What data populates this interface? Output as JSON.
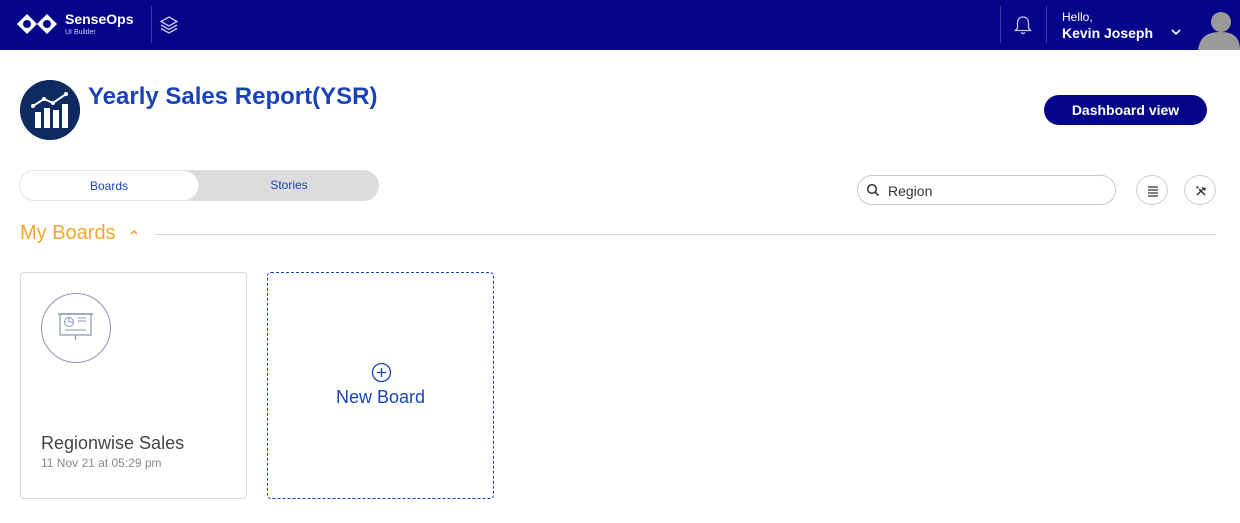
{
  "header": {
    "brand_name": "SenseOps",
    "brand_sub": "UI Builder",
    "greeting": "Hello,",
    "user_name": "Kevin Joseph"
  },
  "report": {
    "title": "Yearly Sales Report(YSR)",
    "dashboard_button": "Dashboard view"
  },
  "tabs": [
    {
      "label": "Boards",
      "active": true
    },
    {
      "label": "Stories",
      "active": false
    }
  ],
  "search": {
    "value": "Region",
    "placeholder": ""
  },
  "section": {
    "title": "My Boards"
  },
  "boards": [
    {
      "name": "Regionwise Sales",
      "date": "11 Nov 21 at 05:29 pm"
    }
  ],
  "new_board": {
    "label": "New Board"
  },
  "colors": {
    "topbar": "#05058a",
    "accent": "#1a43b8",
    "section": "#f4a52b"
  },
  "icons": [
    "senseops-logo-icon",
    "layers-icon",
    "bell-icon",
    "chevron-down-icon",
    "avatar-icon",
    "chart-icon",
    "search-icon",
    "list-icon",
    "tools-icon",
    "chevron-up-icon",
    "presentation-board-icon",
    "plus-circle-icon"
  ]
}
